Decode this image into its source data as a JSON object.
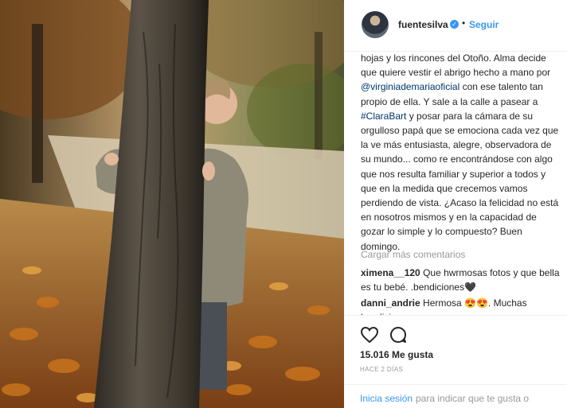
{
  "header": {
    "username": "fuentesilva",
    "dot": "•",
    "follow_label": "Seguir"
  },
  "caption": {
    "part1": "hojas y los rincones del Otoño. Alma decide que quiere vestir el abrigo hecho a mano por ",
    "mention": "@virginiademariaoficial",
    "part2": " con ese talento tan propio de ella. Y sale a la calle a pasear a ",
    "hashtag": "#ClaraBart",
    "part3": " y posar para la cámara de su orgulloso papá que se emociona cada vez que la ve más entusiasta, alegre, observadora de su mundo... como re encontrándose con algo que nos resulta familiar y superior a todos y que en la medida que crecemos vamos perdiendo de vista. ¿Acaso la felicidad no está en nosotros mismos y en la capacidad de gozar lo simple y lo compuesto? Buen domingo."
  },
  "load_more": "Cargar más comentarios",
  "comments": [
    {
      "user": "ximena__120",
      "text": " Que hwrmosas fotos y que bella es tu bebé. .bendiciones🖤"
    },
    {
      "user": "danni_andrie",
      "text": " Hermosa 😍😍. Muchas bendiciones"
    }
  ],
  "actions": {
    "likes": "15.016 Me gusta",
    "time": "HACE 2 DÍAS"
  },
  "login": {
    "link": "Inicia sesión",
    "rest": "para indicar que te gusta o"
  },
  "colors": {
    "accent": "#3897f0",
    "link_dark": "#003569",
    "muted": "#999999"
  }
}
